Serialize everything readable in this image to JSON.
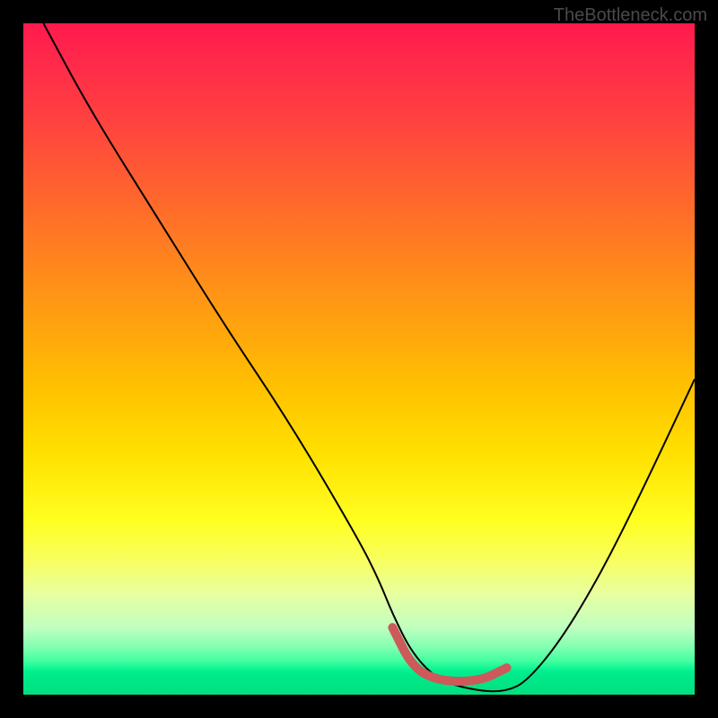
{
  "watermark": "TheBottleneck.com",
  "chart_data": {
    "type": "line",
    "title": "",
    "xlabel": "",
    "ylabel": "",
    "xlim": [
      0,
      100
    ],
    "ylim": [
      0,
      100
    ],
    "background_gradient": {
      "top": "#ff1a4d",
      "middle": "#ffe000",
      "bottom": "#00e080"
    },
    "series": [
      {
        "name": "bottleneck-curve",
        "stroke": "#000000",
        "stroke_width": 2,
        "x": [
          3,
          10,
          20,
          30,
          40,
          50,
          53,
          55,
          58,
          62,
          68,
          72,
          75,
          80,
          86,
          92,
          100
        ],
        "y": [
          100,
          87,
          71,
          55,
          40,
          23,
          17,
          12,
          6,
          2,
          0.5,
          0.5,
          2,
          8,
          18,
          30,
          47
        ]
      },
      {
        "name": "optimal-range-marker",
        "stroke": "#cc5a5a",
        "stroke_width": 10,
        "linecap": "round",
        "x": [
          55,
          58,
          62,
          68,
          72
        ],
        "y": [
          10,
          4,
          2,
          2,
          4
        ]
      }
    ],
    "annotations": []
  }
}
